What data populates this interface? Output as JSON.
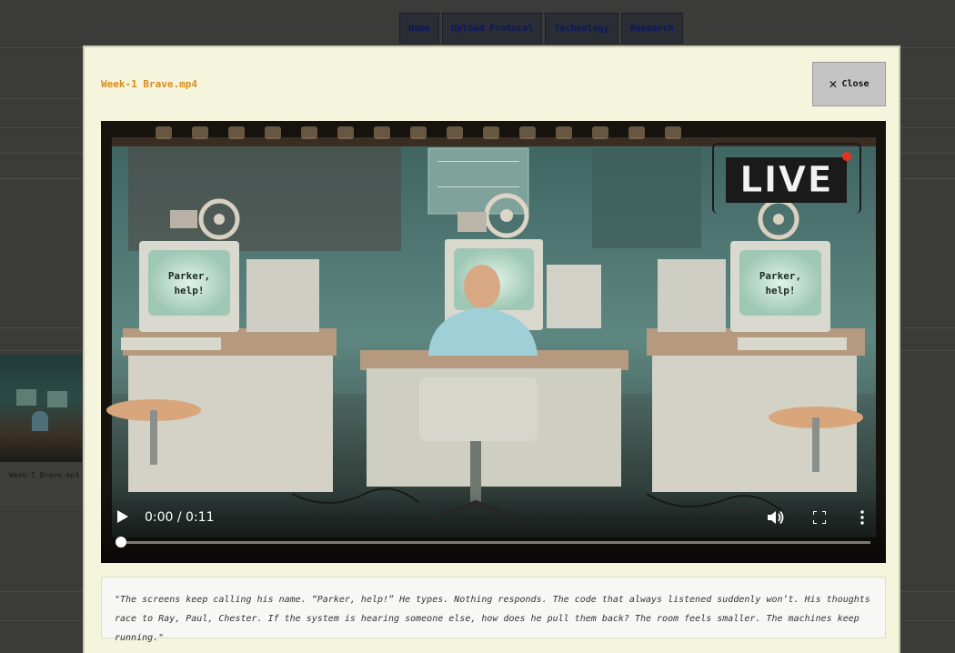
{
  "nav": {
    "items": [
      "Home",
      "Upload Protocol",
      "Technology",
      "Research"
    ]
  },
  "background_gallery": {
    "item_label": "Week-1 Brave.mp4"
  },
  "modal": {
    "title": "Week-1 Brave.mp4",
    "close_label": "Close",
    "close_icon": "close-icon"
  },
  "video": {
    "overlay_badge": "LIVE",
    "screen_text_left": "Parker,\nhelp!",
    "screen_text_right": "Parker,\nhelp!",
    "current_time": "0:00",
    "duration": "0:11",
    "time_display": "0:00 / 0:11",
    "progress": 0,
    "live_dot_color": "#e8321f"
  },
  "caption": {
    "text": "\"The screens keep calling his name. “Parker, help!” He types. Nothing responds. The code that always listened suddenly won’t. His thoughts race to Ray, Paul, Chester. If the system is hearing someone else, how does he pull them back? The room feels smaller. The machines keep running.\""
  },
  "colors": {
    "title_accent": "#d98c1c",
    "modal_background": "#f5f4dc",
    "overlay_background": "#3b3b39",
    "nav_text": "#0b1660"
  }
}
